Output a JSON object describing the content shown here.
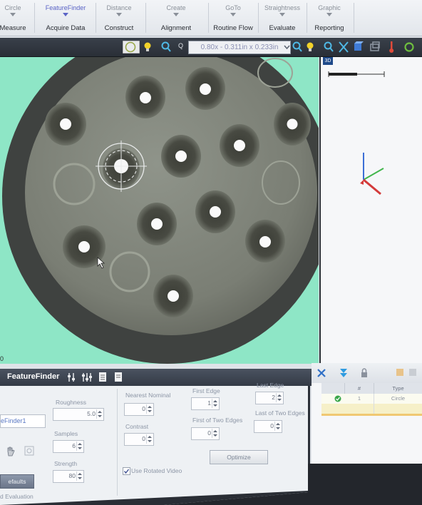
{
  "ribbon": {
    "groups": [
      {
        "tool": "Circle",
        "label": "Measure",
        "active": false
      },
      {
        "tool": "FeatureFinder",
        "label": "Acquire Data",
        "active": true
      },
      {
        "tool": "Distance",
        "label": "Construct",
        "active": false
      },
      {
        "tool": "Create",
        "label": "Alignment",
        "active": false
      },
      {
        "tool": "GoTo",
        "label": "Routine Flow",
        "active": false
      },
      {
        "tool": "Straightness",
        "label": "Evaluate",
        "active": false
      },
      {
        "tool": "Graphic",
        "label": "Reporting",
        "active": false
      }
    ]
  },
  "toolbar": {
    "zoom_readout": "0.80x - 0.311in x 0.233in",
    "zoom_key_label": "Q"
  },
  "pane3d": {
    "label": "3D"
  },
  "video": {
    "edge_number": "0",
    "holes": 13,
    "colors": {
      "background": "#8ee6c6",
      "part": "#7a7e74",
      "hole_ring": "#45473f"
    }
  },
  "featurefinder": {
    "title": "FeatureFinder",
    "name_value": "eFinder1",
    "defaults_button": "efaults",
    "evaluation_label": "d Evaluation",
    "roughness": {
      "label": "Roughness",
      "value": "5.0"
    },
    "samples": {
      "label": "Samples",
      "value": "6"
    },
    "strength": {
      "label": "Strength",
      "value": "80"
    },
    "nearest_nominal": {
      "label": "Nearest Nominal",
      "value": "0"
    },
    "contrast": {
      "label": "Contrast",
      "value": "0"
    },
    "first_edge": {
      "label": "First Edge",
      "value": "1"
    },
    "first_of_two_edges": {
      "label": "First of Two Edges",
      "value": "0"
    },
    "last_edge": {
      "label": "Last Edge",
      "value": "2"
    },
    "last_of_two_edges": {
      "label": "Last of Two Edges",
      "value": "0"
    },
    "use_rotated_video": {
      "label": "Use Rotated Video",
      "checked": true
    },
    "optimize_button": "Optimize"
  },
  "results_table": {
    "columns": [
      "#",
      "Type"
    ],
    "rows": [
      {
        "index": "1",
        "type": "Circle",
        "status": "ok"
      },
      {
        "index": "",
        "type": "",
        "status": ""
      }
    ]
  }
}
